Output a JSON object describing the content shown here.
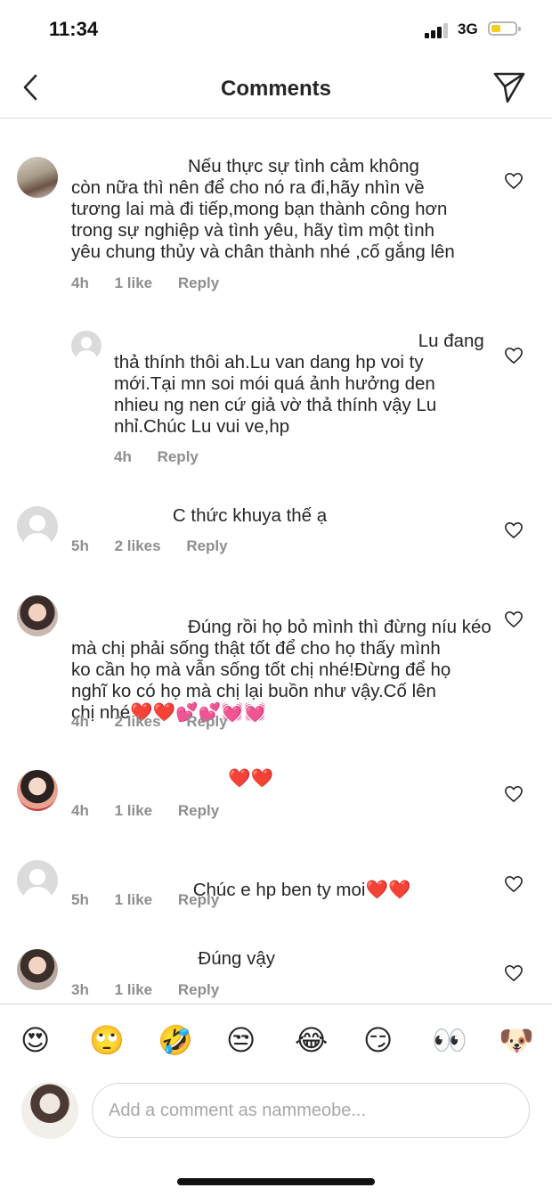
{
  "status_bar": {
    "time": "11:34",
    "network": "3G"
  },
  "header": {
    "title": "Comments"
  },
  "comments": [
    {
      "text": "                       Nếu thực sự tình cảm không\ncòn nữa thì nên để cho nó ra đi,hãy nhìn về\ntương lai mà đi tiếp,mong bạn thành công hơn\ntrong sự nghiệp và tình yêu, hãy tìm một tình\nyêu chung thủy và chân thành nhé ,cố gắng lên",
      "time": "4h",
      "likes": "1 like",
      "reply": "Reply"
    },
    {
      "text": "                                                            Lu đang\nthả thính thôi ah.Lu van dang hp voi ty\nmới.Tại mn soi mói quá ảnh hưởng den\nnhieu ng nen cứ giả vờ thả thính vậy Lu\nnhỉ.Chúc Lu vui ve,hp",
      "time": "4h",
      "reply": "Reply"
    },
    {
      "text": "                    C thức khuya thế ạ",
      "time": "5h",
      "likes": "2 likes",
      "reply": "Reply"
    },
    {
      "text": "                   Đúng rồi họ bỏ mình thì đừng níu kéo\nmà chị phải sống thật tốt để cho họ thấy mình\nko cần họ mà vẫn sống tốt chị nhé!Đừng để họ\nnghĩ ko có họ mà chị lại buồn như vậy.Cố lên\nchị nhé",
      "emoji": "❤️❤️💕💕💓💓",
      "time": "4h",
      "likes": "2 likes",
      "reply": "Reply"
    },
    {
      "emoji": "❤️❤️",
      "time": "4h",
      "likes": "1 like",
      "reply": "Reply"
    },
    {
      "text": "                    Chúc e hp ben ty moi",
      "emoji": "❤️❤️",
      "time": "5h",
      "likes": "1 like",
      "reply": "Reply"
    },
    {
      "text": "                         Đúng vậy",
      "time": "3h",
      "likes": "1 like",
      "reply": "Reply"
    }
  ],
  "emoji_bar": [
    "😍",
    "🙄",
    "🤣",
    "😒",
    "😂",
    "😏",
    "👀",
    "🐶"
  ],
  "composer": {
    "placeholder": "Add a comment as nammeobe..."
  },
  "colors": {
    "meta": "#8e8e8e",
    "text": "#262626",
    "border": "#dbdbdb",
    "battery": "#f5cd22"
  }
}
